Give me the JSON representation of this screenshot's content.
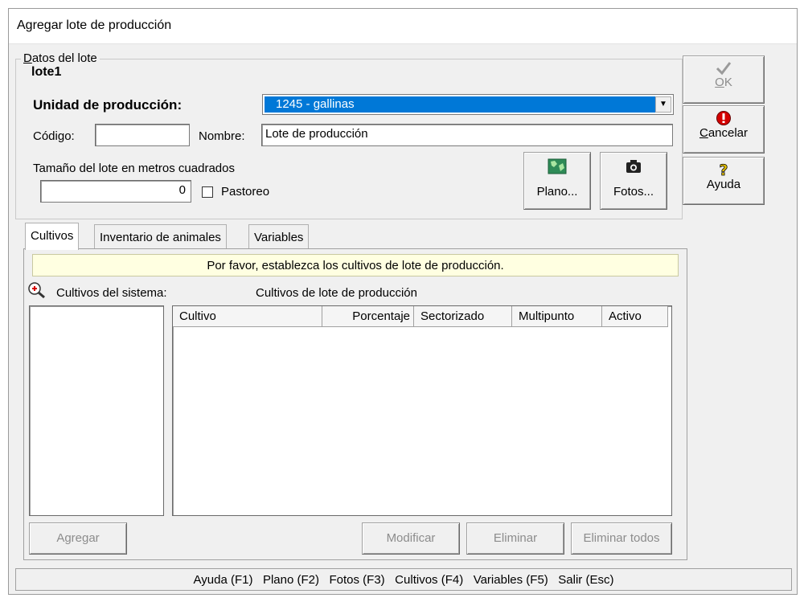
{
  "window": {
    "title": "Agregar lote de producción"
  },
  "lot_group": {
    "legend": "Datos del lote",
    "lot_name": "lote1",
    "unit_label": "Unidad de producción:",
    "unit_selected": "1245 - gallinas",
    "code_label": "Código:",
    "code_value": "",
    "name_label": "Nombre:",
    "name_value": "Lote de producción",
    "size_label": "Tamaño del lote en metros cuadrados",
    "size_value": "0",
    "grazing_label": "Pastoreo",
    "grazing_checked": false,
    "plan_button": "Plano...",
    "photos_button": "Fotos..."
  },
  "side_buttons": {
    "ok": "OK",
    "cancel": "Cancelar",
    "help": "Ayuda"
  },
  "tabs": [
    {
      "label": "Cultivos",
      "active": true
    },
    {
      "label": "Inventario de animales",
      "active": false
    },
    {
      "label": "Variables",
      "active": false
    }
  ],
  "crops_tab": {
    "notice": "Por favor, establezca los cultivos de lote de producción.",
    "system_crops_label": "Cultivos del sistema:",
    "lot_crops_label": "Cultivos de lote de producción",
    "columns": [
      "Cultivo",
      "Porcentaje",
      "Sectorizado",
      "Multipunto",
      "Activo"
    ],
    "rows": [],
    "add_button": "Agregar",
    "modify_button": "Modificar",
    "delete_button": "Eliminar",
    "delete_all_button": "Eliminar todos"
  },
  "status_bar": "Ayuda (F1)   Plano (F2)   Fotos (F3)   Cultivos (F4)   Variables (F5)   Salir (Esc)",
  "icons": {
    "ok": "checkmark-icon",
    "cancel": "stop-icon",
    "help": "question-icon",
    "plan": "map-icon",
    "photos": "camera-icon",
    "zoom": "zoom-in-icon"
  },
  "colors": {
    "selection": "#0078d7",
    "notice_bg": "#ffffe1",
    "cancel_icon": "#d40000",
    "help_icon": "#e6c200",
    "map_icon": "#2e8b57"
  }
}
